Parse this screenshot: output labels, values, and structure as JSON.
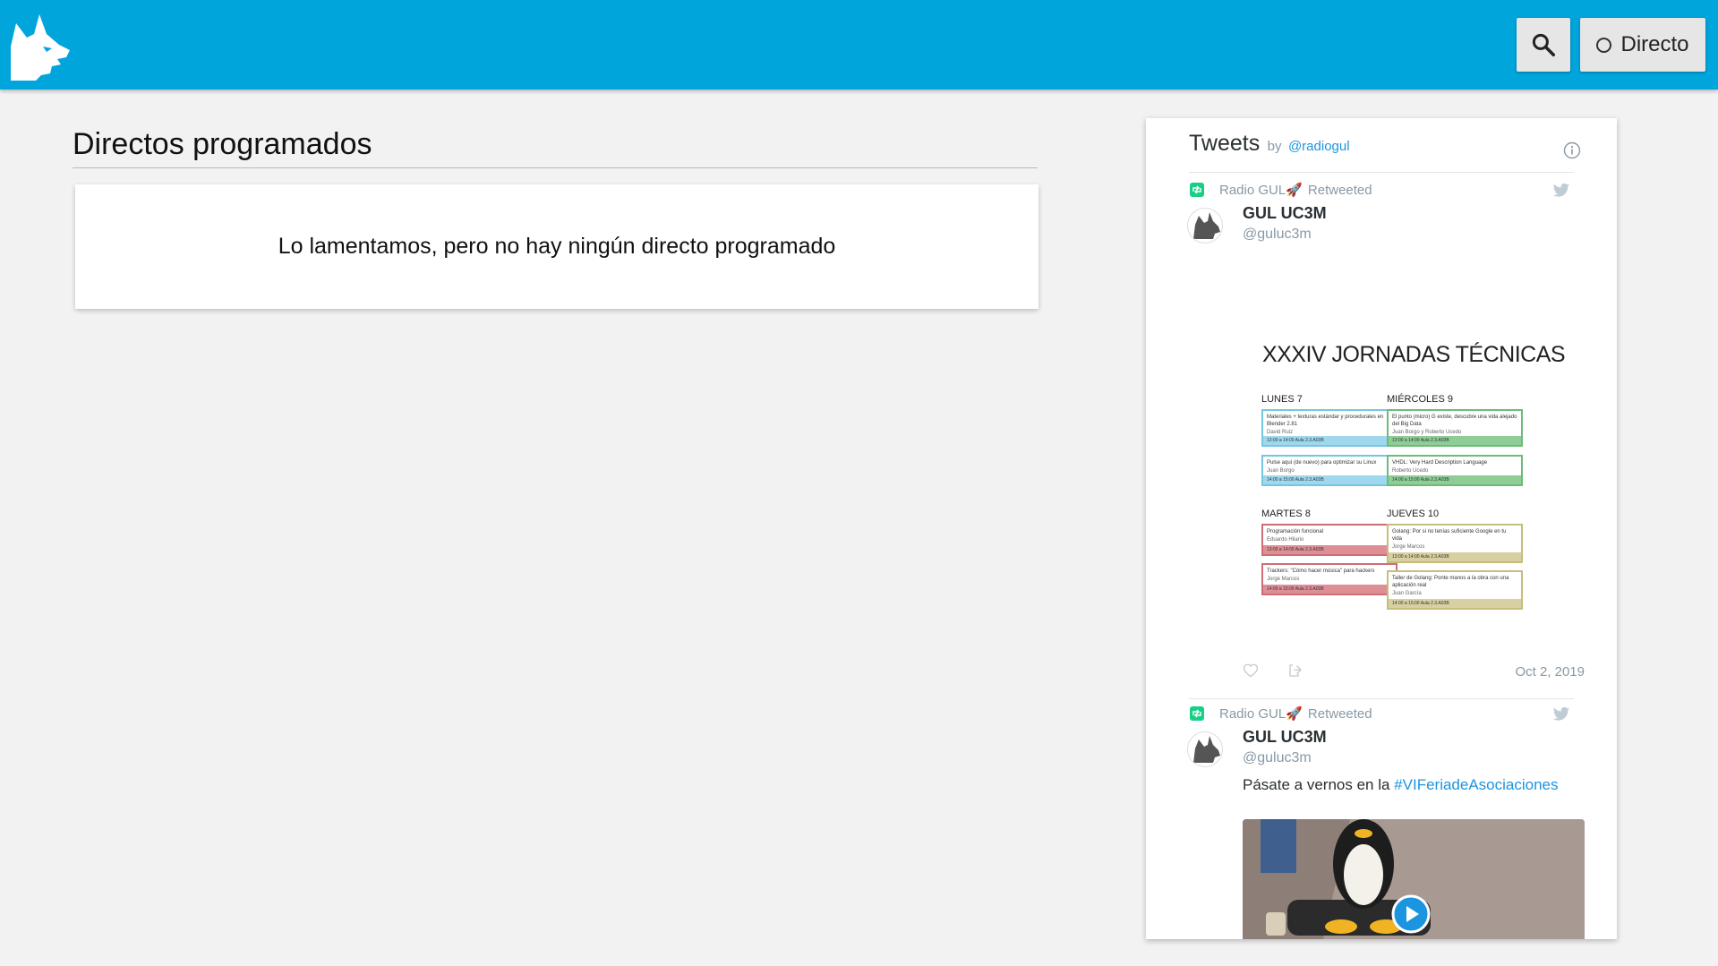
{
  "header": {
    "logo_icon": "lynx-logo-icon",
    "search_icon": "search-icon",
    "live_button_label": "Directo",
    "accent_color": "#00a5dc"
  },
  "main": {
    "title": "Directos programados",
    "empty_message": "Lo lamentamos, pero no hay ningún directo programado"
  },
  "widget": {
    "title": "Tweets",
    "by": "by",
    "handle": "@radiogul",
    "tweets": [
      {
        "retweeted_by": "Radio GUL🚀",
        "retweeted_label": "Retweeted",
        "author_name": "GUL UC3M",
        "author_handle": "@guluc3m",
        "date": "Oct 2, 2019",
        "poster": {
          "title": "XXXIV JORNADAS TÉCNICAS",
          "days": [
            "LUNES 7",
            "MIÉRCOLES 9",
            "MARTES 8",
            "JUEVES 10"
          ],
          "events": [
            {
              "title": "Materiales + texturas estándar y procedurales en Blender 2.81",
              "speaker": "David Ruiz",
              "footer": "13:00 a 14:00  Aula 2.3.A03B"
            },
            {
              "title": "Pulse aquí (de nuevo) para optimizar su Linux",
              "speaker": "Juan Borgo",
              "footer": "14:00 a 15:00  Aula 2.3.A03B"
            },
            {
              "title": "El punto (micro) G existe, descubre una vida alejado del Big Data",
              "speaker": "Juan Borgo y Roberto Ucedo",
              "footer": "13:00 a 14:00  Aula 2.3.A03B"
            },
            {
              "title": "VHDL: Very Hard Description Language",
              "speaker": "Roberto Ucedo",
              "footer": "14:00 a 15:00  Aula 2.3.A03B"
            },
            {
              "title": "Programación funcional",
              "speaker": "Eduardo Hilario",
              "footer": "13:00 a 14:00  Aula 2.3.A03B"
            },
            {
              "title": "Trackers: \"Cómo hacer música\" para hackers",
              "speaker": "Jorge Marcos",
              "footer": "14:00 a 15:00  Aula 2.3.A03B"
            },
            {
              "title": "Golang: Por si no tenías suficiente Google en tu vida",
              "speaker": "Jorge Marcos",
              "footer": "13:00 a 14:00  Aula 2.3.A03B"
            },
            {
              "title": "Taller de Golang: Ponte manos a la obra con una aplicación real",
              "speaker": "Juan García",
              "footer": "14:00 a 15:00  Aula 2.3.A03B"
            }
          ]
        }
      },
      {
        "retweeted_by": "Radio GUL🚀",
        "retweeted_label": "Retweeted",
        "author_name": "GUL UC3M",
        "author_handle": "@guluc3m",
        "text_prefix": "Pásate a vernos en la ",
        "hashtag": "#VIFeriadeAsociaciones"
      }
    ]
  }
}
